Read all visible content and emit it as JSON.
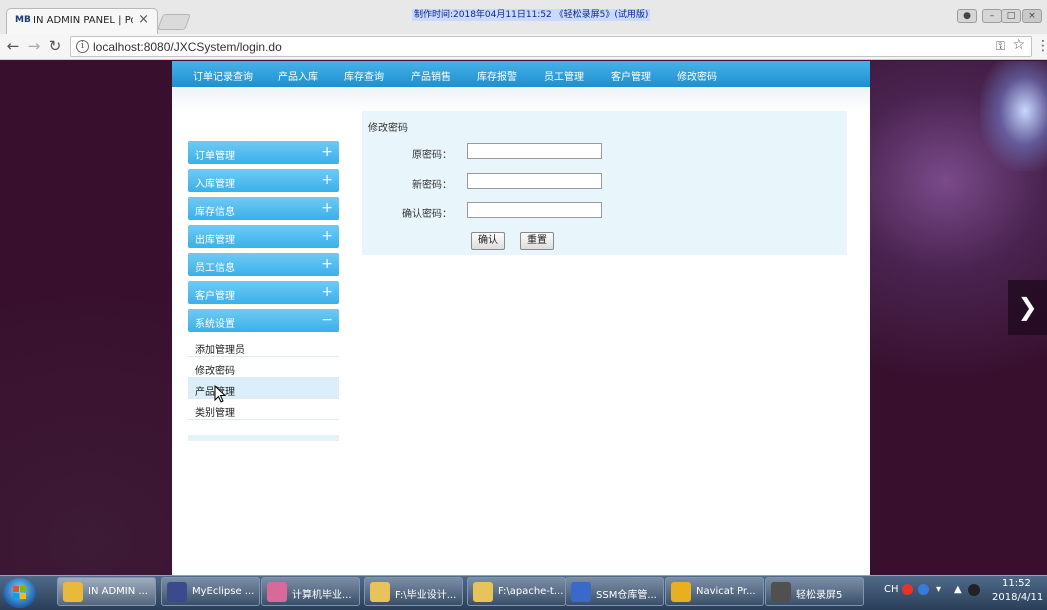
{
  "browser": {
    "tab_title": "IN ADMIN PANEL | Po",
    "tab_favicon": "MB",
    "url": "localhost:8080/JXCSystem/login.do",
    "recording_banner": "制作时间:2018年04月11日11:52 《轻松录屏5》(试用版)",
    "icons": {
      "back": "back-arrow-icon",
      "forward": "forward-arrow-icon",
      "reload": "reload-icon",
      "info": "info-icon",
      "key": "key-icon",
      "bookmark": "star-icon",
      "menu": "kebab-menu-icon"
    }
  },
  "topnav": {
    "items": [
      "订单记录查询",
      "产品入库",
      "库存查询",
      "产品销售",
      "库存报警",
      "员工管理",
      "客户管理",
      "修改密码"
    ]
  },
  "sidebar": {
    "groups": [
      {
        "label": "订单管理",
        "toggle": "+"
      },
      {
        "label": "入库管理",
        "toggle": "+"
      },
      {
        "label": "库存信息",
        "toggle": "+"
      },
      {
        "label": "出库管理",
        "toggle": "+"
      },
      {
        "label": "员工信息",
        "toggle": "+"
      },
      {
        "label": "客户管理",
        "toggle": "+"
      },
      {
        "label": "系统设置",
        "toggle": "−"
      }
    ],
    "sub_items": [
      "添加管理员",
      "修改密码",
      "产品管理",
      "类别管理"
    ]
  },
  "form": {
    "title": "修改密码",
    "old_password_label": "原密码：",
    "new_password_label": "新密码：",
    "confirm_password_label": "确认密码：",
    "old_password_value": "",
    "new_password_value": "",
    "confirm_password_value": "",
    "confirm_button": "确认",
    "reset_button": "重置"
  },
  "taskbar": {
    "tasks": [
      {
        "label": "IN ADMIN ...",
        "icon": "chrome-icon",
        "color": "#e8b93a"
      },
      {
        "label": "MyEclipse ...",
        "icon": "myeclipse-icon",
        "color": "#3a4a8a"
      },
      {
        "label": "计算机毕业...",
        "icon": "chat-app-icon",
        "color": "#d86a9a"
      },
      {
        "label": "F:\\毕业设计...",
        "icon": "folder-icon",
        "color": "#e8c25a"
      },
      {
        "label": "F:\\apache-t...",
        "icon": "folder-icon",
        "color": "#e8c25a"
      },
      {
        "label": "SSM仓库管...",
        "icon": "word-document-icon",
        "color": "#3a6ac8"
      },
      {
        "label": "Navicat Pr...",
        "icon": "navicat-icon",
        "color": "#e8b020"
      },
      {
        "label": "轻松录屏5",
        "icon": "screen-recorder-icon",
        "color": "#505050"
      }
    ],
    "tray": {
      "ime": "CH",
      "time": "11:52",
      "date": "2018/4/11"
    }
  },
  "colors": {
    "nav_blue": "#2a9ad8",
    "sidebar_blue": "#4ab8ec",
    "form_bg": "#e8f6fc"
  }
}
